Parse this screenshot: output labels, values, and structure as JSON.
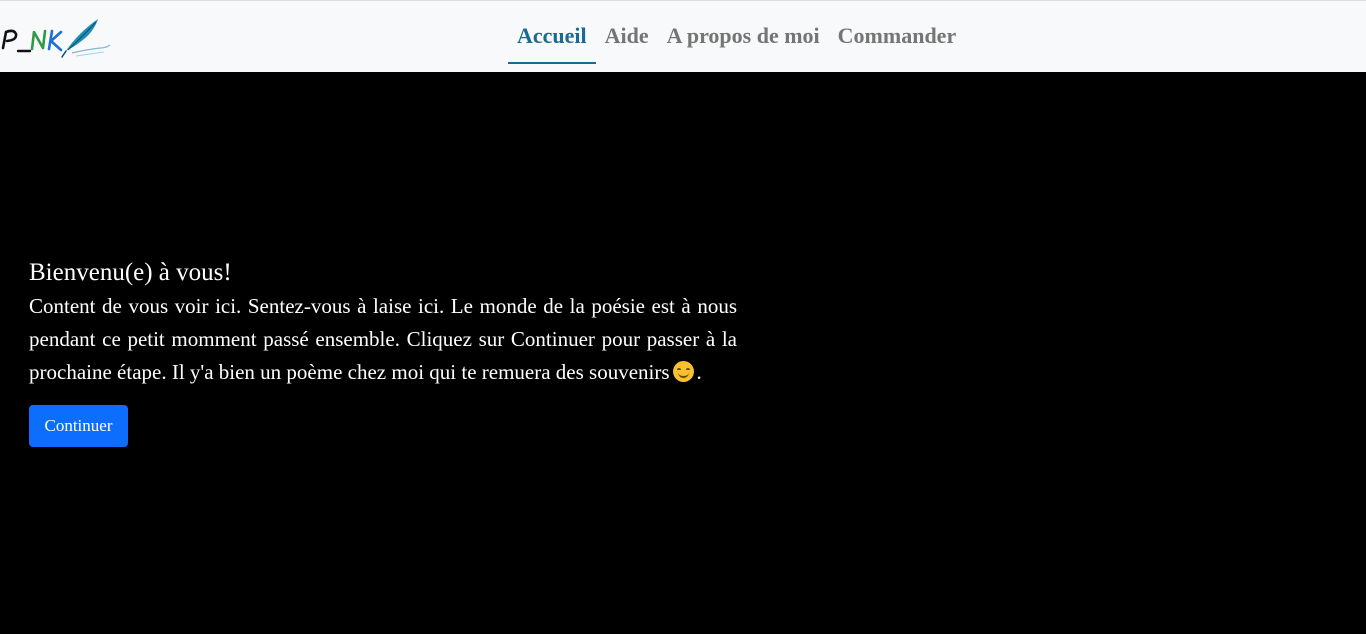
{
  "header": {
    "logo_text": "P_NK",
    "nav": [
      {
        "label": "Accueil",
        "active": true
      },
      {
        "label": "Aide",
        "active": false
      },
      {
        "label": "A propos de moi",
        "active": false
      },
      {
        "label": "Commander",
        "active": false
      }
    ]
  },
  "hero": {
    "title": "Bienvenu(e) à vous!",
    "text": "Content de vous voir ici. Sentez-vous à laise ici. Le monde de la poésie est à nous pendant ce petit momment passé ensemble. Cliquez sur Continuer pour passer à la prochaine étape. Il y'a bien un poème chez moi qui te remuera des souvenirs",
    "text_end": ".",
    "emoji_icon": "smiling-face-emoji",
    "button_label": "Continuer"
  },
  "colors": {
    "navbar_bg": "#f8f9fa",
    "nav_active": "#1a6a94",
    "nav_inactive": "#757575",
    "page_bg": "#000000",
    "button_bg": "#0d6efd"
  }
}
